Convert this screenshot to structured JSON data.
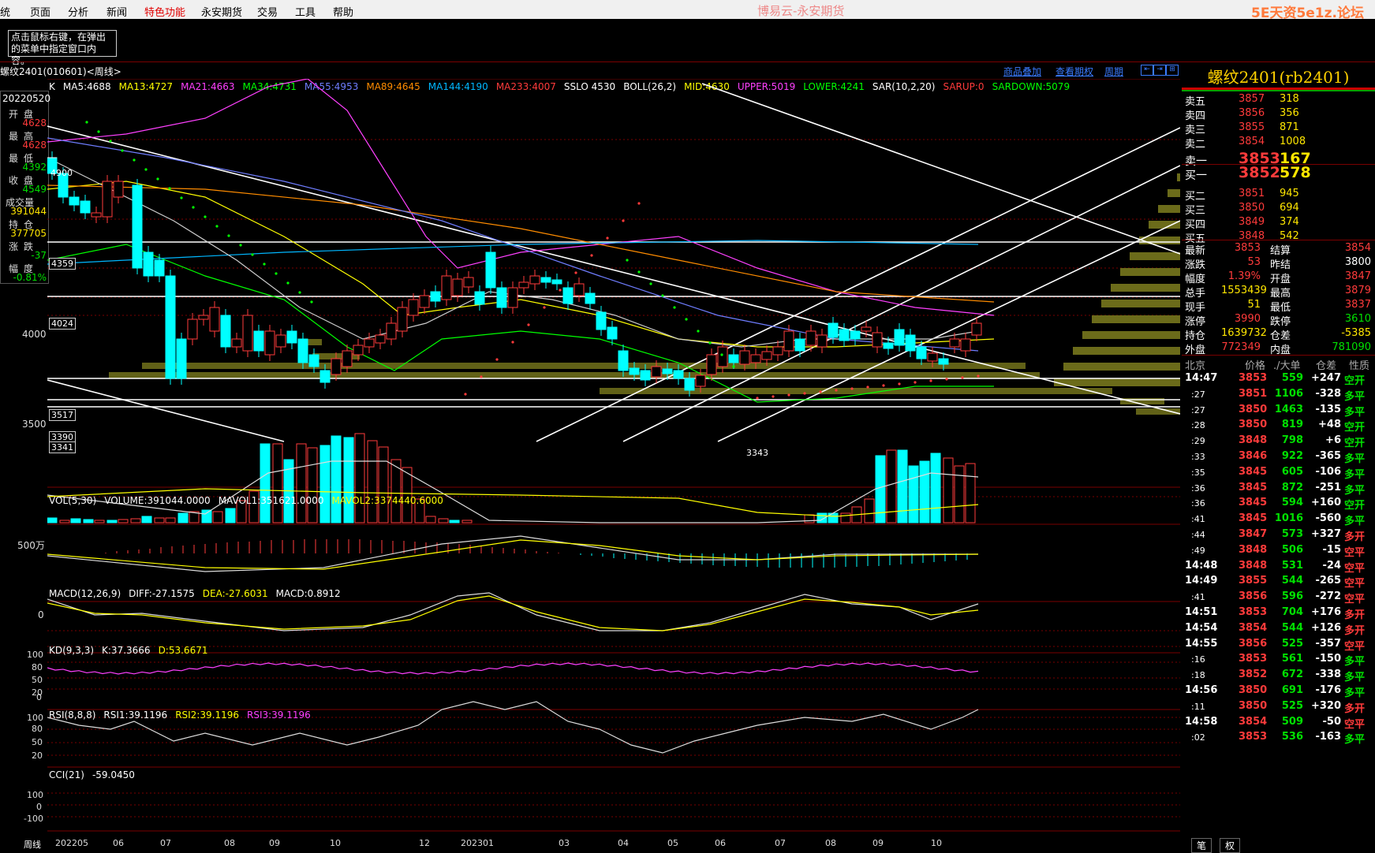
{
  "menu": {
    "items": [
      "统",
      "页面",
      "分析",
      "新闻",
      "特色功能",
      "永安期货",
      "交易",
      "工具",
      "帮助"
    ],
    "active_index": 4,
    "app_title": "博易云-永安期货",
    "watermark": "5E天资5e1z.论坛"
  },
  "tip": "点击鼠标右键，在弹出的菜单中指定窗口内容。",
  "header": {
    "symbol": "螺纹2401(010601)<周线>",
    "links": [
      "商品叠加",
      "查看期权",
      "周期"
    ]
  },
  "main_indicators": [
    {
      "text": "K",
      "color": "#ffffff"
    },
    {
      "text": "MA5:4688",
      "color": "#ffffff"
    },
    {
      "text": "MA13:4727",
      "color": "#ffff00"
    },
    {
      "text": "MA21:4663",
      "color": "#ff40ff"
    },
    {
      "text": "MA34:4731",
      "color": "#00ff00"
    },
    {
      "text": "MA55:4953",
      "color": "#6f7dff"
    },
    {
      "text": "MA89:4645",
      "color": "#ff8c00"
    },
    {
      "text": "MA144:4190",
      "color": "#00b7ff"
    },
    {
      "text": "MA233:4007",
      "color": "#ff3b3b"
    },
    {
      "text": "SSLO 4530",
      "color": "#ffffff"
    },
    {
      "text": "BOLL(26,2)",
      "color": "#ffffff"
    },
    {
      "text": "MID:4630",
      "color": "#ffff00"
    },
    {
      "text": "UPPER:5019",
      "color": "#ff40ff"
    },
    {
      "text": "LOWER:4241",
      "color": "#00ff00"
    },
    {
      "text": "SAR(10,2,20)",
      "color": "#ffffff"
    },
    {
      "text": "SARUP:0",
      "color": "#ff3b3b"
    },
    {
      "text": "SARDOWN:5079",
      "color": "#00ff00"
    }
  ],
  "left_info": {
    "date": "20220520",
    "rows": [
      {
        "label": "开盘",
        "value": "4628",
        "color": "#ff3b3b"
      },
      {
        "label": "最高",
        "value": "4628",
        "color": "#ff3b3b"
      },
      {
        "label": "最低",
        "value": "4392",
        "color": "#00e000"
      },
      {
        "label": "收盘",
        "value": "4549",
        "color": "#00e000"
      },
      {
        "label": "成交量",
        "value": "391044",
        "color": "#ffe600"
      },
      {
        "label": "持仓",
        "value": "377705",
        "color": "#ffe600"
      },
      {
        "label": "涨跌",
        "value": "-37",
        "color": "#00e000"
      },
      {
        "label": "幅度",
        "value": "-0.81%",
        "color": "#00e000"
      }
    ]
  },
  "price_axis": [
    "4000",
    "3500"
  ],
  "price_tags": [
    "4900",
    "4359",
    "4024",
    "3517",
    "3390",
    "3341",
    "3343"
  ],
  "vol_panel": {
    "items": [
      {
        "text": "VOL(5,30)",
        "color": "#ffffff"
      },
      {
        "text": "VOLUME:391044.0000",
        "color": "#ffffff"
      },
      {
        "text": "MAVOL1:351621.0000",
        "color": "#ffffff"
      },
      {
        "text": "MAVOL2:3374440.6000",
        "color": "#ffff00"
      }
    ],
    "axis": "500万"
  },
  "macd_panel": {
    "items": [
      {
        "text": "MACD(12,26,9)",
        "color": "#ffffff"
      },
      {
        "text": "DIFF:-27.1575",
        "color": "#ffffff"
      },
      {
        "text": "DEA:-27.6031",
        "color": "#ffff00"
      },
      {
        "text": "MACD:0.8912",
        "color": "#ffffff"
      }
    ],
    "axis": "0"
  },
  "kd_panel": {
    "items": [
      {
        "text": "KD(9,3,3)",
        "color": "#ffffff"
      },
      {
        "text": "K:37.3666",
        "color": "#ffffff"
      },
      {
        "text": "D:53.6671",
        "color": "#ffff00"
      }
    ],
    "axis": [
      "100",
      "80",
      "50",
      "20",
      "0"
    ]
  },
  "rsi_panel": {
    "items": [
      {
        "text": "RSI(8,8,8)",
        "color": "#ffffff"
      },
      {
        "text": "RSI1:39.1196",
        "color": "#ffffff"
      },
      {
        "text": "RSI2:39.1196",
        "color": "#ffff00"
      },
      {
        "text": "RSI3:39.1196",
        "color": "#ff40ff"
      }
    ],
    "axis": [
      "100",
      "80",
      "50",
      "20"
    ]
  },
  "cci_panel": {
    "items": [
      {
        "text": "CCI(21)",
        "color": "#ffffff"
      },
      {
        "text": "-59.0450",
        "color": "#ffffff"
      }
    ],
    "axis": [
      "100",
      "0",
      "-100"
    ]
  },
  "x_axis": {
    "period": "周线",
    "labels": [
      "202205",
      "06",
      "07",
      "08",
      "09",
      "10",
      "12",
      "202301",
      "03",
      "04",
      "05",
      "06",
      "07",
      "08",
      "09",
      "10"
    ]
  },
  "quote": {
    "title": "螺纹2401(rb2401)",
    "asks": [
      {
        "label": "卖五",
        "price": "3857",
        "vol": "318"
      },
      {
        "label": "卖四",
        "price": "3856",
        "vol": "356"
      },
      {
        "label": "卖三",
        "price": "3855",
        "vol": "871"
      },
      {
        "label": "卖二",
        "price": "3854",
        "vol": "1008"
      },
      {
        "label": "卖一",
        "price": "3853",
        "vol": "167"
      }
    ],
    "bids": [
      {
        "label": "买一",
        "price": "3852",
        "vol": "578"
      },
      {
        "label": "买二",
        "price": "3851",
        "vol": "945"
      },
      {
        "label": "买三",
        "price": "3850",
        "vol": "694"
      },
      {
        "label": "买四",
        "price": "3849",
        "vol": "374"
      },
      {
        "label": "买五",
        "price": "3848",
        "vol": "542"
      }
    ],
    "stats": [
      {
        "l1": "最新",
        "v1": "3853",
        "c1": "#ff3b3b",
        "l2": "结算",
        "v2": "3854",
        "c2": "#ff3b3b"
      },
      {
        "l1": "涨跌",
        "v1": "53",
        "c1": "#ff3b3b",
        "l2": "昨结",
        "v2": "3800",
        "c2": "#ffffff"
      },
      {
        "l1": "幅度",
        "v1": "1.39%",
        "c1": "#ff3b3b",
        "l2": "开盘",
        "v2": "3847",
        "c2": "#ff3b3b"
      },
      {
        "l1": "总手",
        "v1": "1553439",
        "c1": "#ffe600",
        "l2": "最高",
        "v2": "3879",
        "c2": "#ff3b3b"
      },
      {
        "l1": "现手",
        "v1": "51",
        "c1": "#ffe600",
        "l2": "最低",
        "v2": "3837",
        "c2": "#ff3b3b"
      },
      {
        "l1": "涨停",
        "v1": "3990",
        "c1": "#ff3b3b",
        "l2": "跌停",
        "v2": "3610",
        "c2": "#00e000"
      },
      {
        "l1": "持仓",
        "v1": "1639732",
        "c1": "#ffe600",
        "l2": "仓差",
        "v2": "-5385",
        "c2": "#ffe600"
      },
      {
        "l1": "外盘",
        "v1": "772349",
        "c1": "#ff3b3b",
        "l2": "内盘",
        "v2": "781090",
        "c2": "#00e000"
      }
    ],
    "tick_header": [
      "北京",
      "价格",
      "./大单",
      "仓差",
      "性质"
    ],
    "ticks": [
      {
        "time": "14:47",
        "price": "3853",
        "vol": "559",
        "diff": "+247",
        "nature": "空开",
        "nc": "#00e000",
        "big": true
      },
      {
        "time": ":27",
        "price": "3851",
        "vol": "1106",
        "diff": "-328",
        "nature": "多平",
        "nc": "#00e000",
        "big": false
      },
      {
        "time": ":27",
        "price": "3850",
        "vol": "1463",
        "diff": "-135",
        "nature": "多平",
        "nc": "#00e000",
        "big": false
      },
      {
        "time": ":28",
        "price": "3850",
        "vol": "819",
        "diff": "+48",
        "nature": "空开",
        "nc": "#00e000",
        "big": false
      },
      {
        "time": ":29",
        "price": "3848",
        "vol": "798",
        "diff": "+6",
        "nature": "空开",
        "nc": "#00e000",
        "big": false
      },
      {
        "time": ":33",
        "price": "3846",
        "vol": "922",
        "diff": "-365",
        "nature": "多平",
        "nc": "#00e000",
        "big": false
      },
      {
        "time": ":35",
        "price": "3845",
        "vol": "605",
        "diff": "-106",
        "nature": "多平",
        "nc": "#00e000",
        "big": false
      },
      {
        "time": ":36",
        "price": "3845",
        "vol": "872",
        "diff": "-251",
        "nature": "多平",
        "nc": "#00e000",
        "big": false
      },
      {
        "time": ":36",
        "price": "3845",
        "vol": "594",
        "diff": "+160",
        "nature": "空开",
        "nc": "#00e000",
        "big": false
      },
      {
        "time": ":41",
        "price": "3845",
        "vol": "1016",
        "diff": "-560",
        "nature": "多平",
        "nc": "#00e000",
        "big": false
      },
      {
        "time": ":44",
        "price": "3847",
        "vol": "573",
        "diff": "+327",
        "nature": "多开",
        "nc": "#ff3b3b",
        "big": false
      },
      {
        "time": ":49",
        "price": "3848",
        "vol": "506",
        "diff": "-15",
        "nature": "空平",
        "nc": "#ff3b3b",
        "big": false
      },
      {
        "time": "14:48",
        "price": "3848",
        "vol": "531",
        "diff": "-24",
        "nature": "空平",
        "nc": "#ff3b3b",
        "big": true
      },
      {
        "time": "14:49",
        "price": "3855",
        "vol": "544",
        "diff": "-265",
        "nature": "空平",
        "nc": "#ff3b3b",
        "big": true
      },
      {
        "time": ":41",
        "price": "3856",
        "vol": "596",
        "diff": "-272",
        "nature": "空平",
        "nc": "#ff3b3b",
        "big": false
      },
      {
        "time": "14:51",
        "price": "3853",
        "vol": "704",
        "diff": "+176",
        "nature": "多开",
        "nc": "#ff3b3b",
        "big": true
      },
      {
        "time": "14:54",
        "price": "3854",
        "vol": "544",
        "diff": "+126",
        "nature": "多开",
        "nc": "#ff3b3b",
        "big": true
      },
      {
        "time": "14:55",
        "price": "3856",
        "vol": "525",
        "diff": "-357",
        "nature": "空平",
        "nc": "#ff3b3b",
        "big": true
      },
      {
        "time": ":16",
        "price": "3853",
        "vol": "561",
        "diff": "-150",
        "nature": "多平",
        "nc": "#00e000",
        "big": false
      },
      {
        "time": ":18",
        "price": "3852",
        "vol": "672",
        "diff": "-338",
        "nature": "多平",
        "nc": "#00e000",
        "big": false
      },
      {
        "time": "14:56",
        "price": "3850",
        "vol": "691",
        "diff": "-176",
        "nature": "多平",
        "nc": "#00e000",
        "big": true
      },
      {
        "time": ":11",
        "price": "3850",
        "vol": "525",
        "diff": "+320",
        "nature": "多开",
        "nc": "#ff3b3b",
        "big": false
      },
      {
        "time": "14:58",
        "price": "3854",
        "vol": "509",
        "diff": "-50",
        "nature": "空平",
        "nc": "#ff3b3b",
        "big": true
      },
      {
        "time": ":02",
        "price": "3853",
        "vol": "536",
        "diff": "-163",
        "nature": "多平",
        "nc": "#00e000",
        "big": false
      }
    ],
    "bottom_tabs": [
      "笔",
      "权"
    ]
  },
  "colors": {
    "up": "#ff3b3b",
    "down": "#00ffff",
    "background": "#000000",
    "grid": "#7a0000"
  }
}
